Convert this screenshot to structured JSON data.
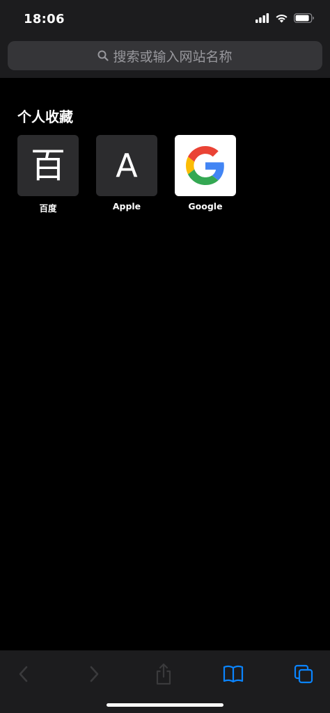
{
  "status_bar": {
    "time": "18:06"
  },
  "address_bar": {
    "placeholder": "搜索或输入网站名称"
  },
  "favorites": {
    "title": "个人收藏",
    "items": [
      {
        "tile_text": "百",
        "label": "百度"
      },
      {
        "tile_text": "A",
        "label": "Apple"
      },
      {
        "tile_text": "",
        "label": "Google"
      }
    ]
  },
  "toolbar": {
    "icons": [
      "back-icon",
      "forward-icon",
      "share-icon",
      "bookmarks-icon",
      "tabs-icon"
    ],
    "accent_color": "#0a84ff",
    "disabled_color": "#3a3a3c"
  },
  "theme": {
    "background": "#000000",
    "chrome": "#1c1c1e",
    "search_field": "#353538",
    "tile": "#2c2c2e"
  }
}
